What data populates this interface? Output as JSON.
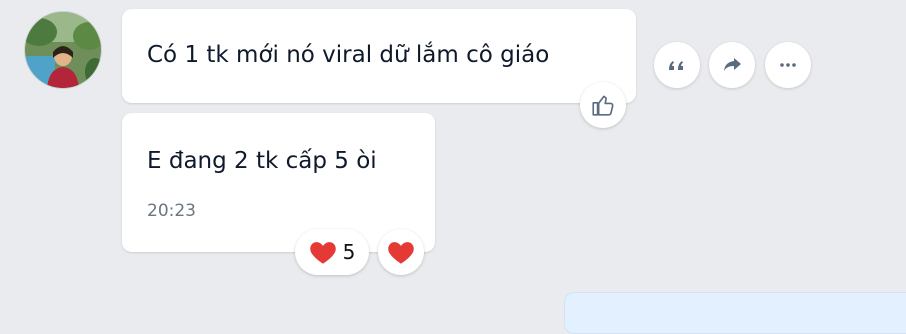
{
  "messages": [
    {
      "text": "Có 1 tk mới nó viral dữ lắm cô giáo"
    },
    {
      "text": "E đang 2 tk cấp 5 òi",
      "time": "20:23"
    }
  ],
  "reactions": [
    {
      "icon": "heart-icon",
      "count": "5"
    },
    {
      "icon": "heart-icon"
    }
  ],
  "actions": [
    "quote-icon",
    "share-icon",
    "more-icon",
    "thumbs-up-icon"
  ],
  "colors": {
    "heart": "#e53935",
    "icon": "#5a6b80",
    "background": "#e9ebee",
    "outgoing_bubble": "#e3f0ff"
  }
}
